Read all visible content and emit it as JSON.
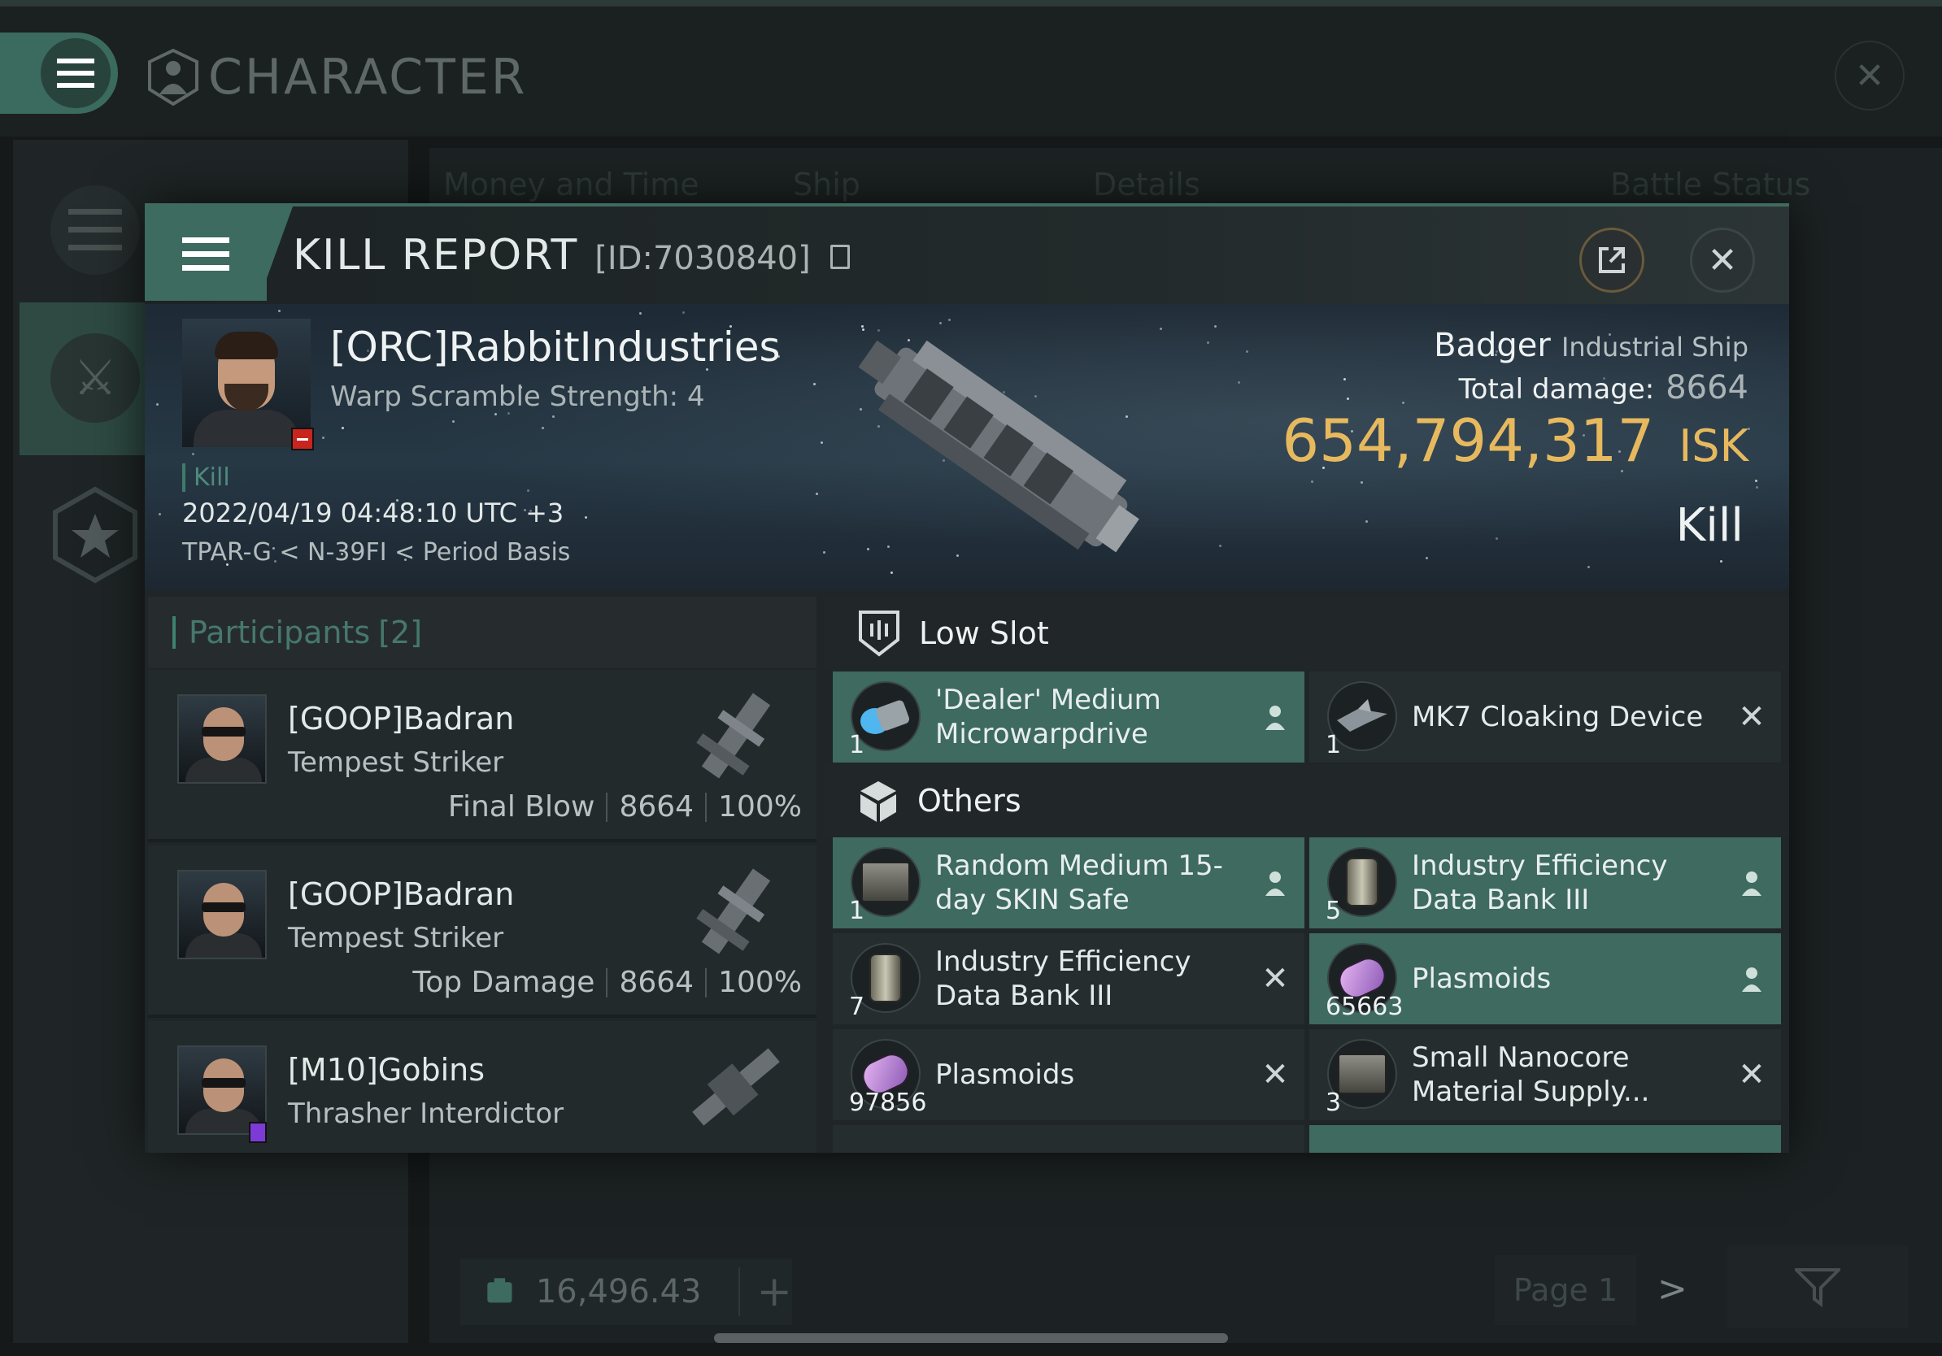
{
  "background": {
    "window_title": "CHARACTER",
    "columns": [
      "Money and Time",
      "Ship",
      "Details",
      "Battle Status"
    ],
    "bottom_bar": {
      "value": "16,496.43"
    },
    "page_label": "Page 1"
  },
  "kill_report": {
    "title": "KILL REPORT",
    "id_label": "[ID:7030840]",
    "victim": {
      "name": "[ORC]RabbitIndustries",
      "warp_scramble": "Warp Scramble Strength: 4",
      "result_tag": "Kill",
      "datetime": "2022/04/19 04:48:10 UTC +3",
      "location": "TPAR-G < N-39FI < Period Basis"
    },
    "ship": {
      "name": "Badger",
      "class": "Industrial Ship",
      "total_damage_label": "Total damage:",
      "total_damage": "8664",
      "isk_value": "654,794,317",
      "isk_unit": "ISK",
      "result": "Kill"
    },
    "participants": {
      "label": "Participants",
      "count": "[2]",
      "list": [
        {
          "name": "[GOOP]Badran",
          "ship": "Tempest Striker",
          "role": "Final Blow",
          "damage": "8664",
          "percent": "100%"
        },
        {
          "name": "[GOOP]Badran",
          "ship": "Tempest Striker",
          "role": "Top Damage",
          "damage": "8664",
          "percent": "100%"
        },
        {
          "name": "[M10]Gobins",
          "ship": "Thrasher Interdictor"
        }
      ]
    },
    "sections": {
      "low_slot": {
        "label": "Low Slot",
        "items": [
          {
            "name": "'Dealer' Medium Microwarpdrive",
            "qty": "1",
            "status": "dropped"
          },
          {
            "name": "MK7 Cloaking Device",
            "qty": "1",
            "status": "destroyed"
          }
        ]
      },
      "others": {
        "label": "Others",
        "items": [
          {
            "name": "Random Medium 15-day SKIN Safe",
            "qty": "1",
            "status": "dropped"
          },
          {
            "name": "Industry Efficiency Data Bank III",
            "qty": "5",
            "status": "dropped"
          },
          {
            "name": "Industry Efficiency Data Bank III",
            "qty": "7",
            "status": "destroyed"
          },
          {
            "name": "Plasmoids",
            "qty": "65663",
            "status": "dropped"
          },
          {
            "name": "Plasmoids",
            "qty": "97856",
            "status": "destroyed"
          },
          {
            "name": "Small Nanocore Material Supply...",
            "qty": "3",
            "status": "destroyed"
          }
        ]
      }
    }
  },
  "colors": {
    "accent_green": "#3e6a60",
    "isk_gold": "#e7b95e",
    "panel_dark": "#262d2e"
  }
}
